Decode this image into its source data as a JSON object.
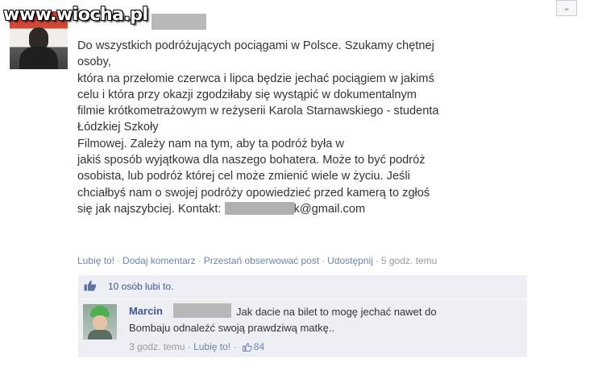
{
  "watermark": "www.wiocha.pl",
  "window": {
    "close_icon": "chevron-down-icon"
  },
  "post": {
    "lines": [
      "Do wszystkich podróżujących pociągami w Polsce. Szukamy chętnej",
      "osoby,",
      "która na przełomie czerwca i lipca będzie jechać pociągiem w jakimś",
      "celu i która przy okazji zgodziłaby się wystąpić w dokumentalnym",
      "filmie krótkometrażowym w reżyserii Karola Starnawskiego - studenta",
      "Łódzkiej Szkoły",
      "Filmowej. Zależy nam na tym, aby ta podróż była w",
      "jakiś sposób wyjątkowa dla naszego bohatera. Może to być podróż",
      "osobista, lub podróż której cel może zmienić wiele w życiu. Jeśli",
      "chciałbyś nam o swojej podróży opowiedzieć przed kamerą to zgłoś"
    ],
    "contact_label": "się jak najszybciej. Kontakt:",
    "email_suffix": "k@gmail.com"
  },
  "actions": {
    "like": "Lubię to!",
    "comment": "Dodaj komentarz",
    "unfollow": "Przestań obserwować post",
    "share": "Udostępnij",
    "time": "5 godz. temu",
    "separator": "·"
  },
  "likes": {
    "text": "10 osób lubi to.",
    "icon": "thumbs-up-icon"
  },
  "comment": {
    "author": "Marcin",
    "text_line1": "Jak dacie na bilet to mogę jechać nawet do",
    "text_line2": "Bombaju odnaleźć swoją prawdziwą matkę..",
    "time": "3 godz. temu",
    "like": "Lubię to!",
    "like_count": "84"
  },
  "colors": {
    "link": "#6d84b4",
    "name": "#3b5998",
    "panel": "#edeff4"
  }
}
